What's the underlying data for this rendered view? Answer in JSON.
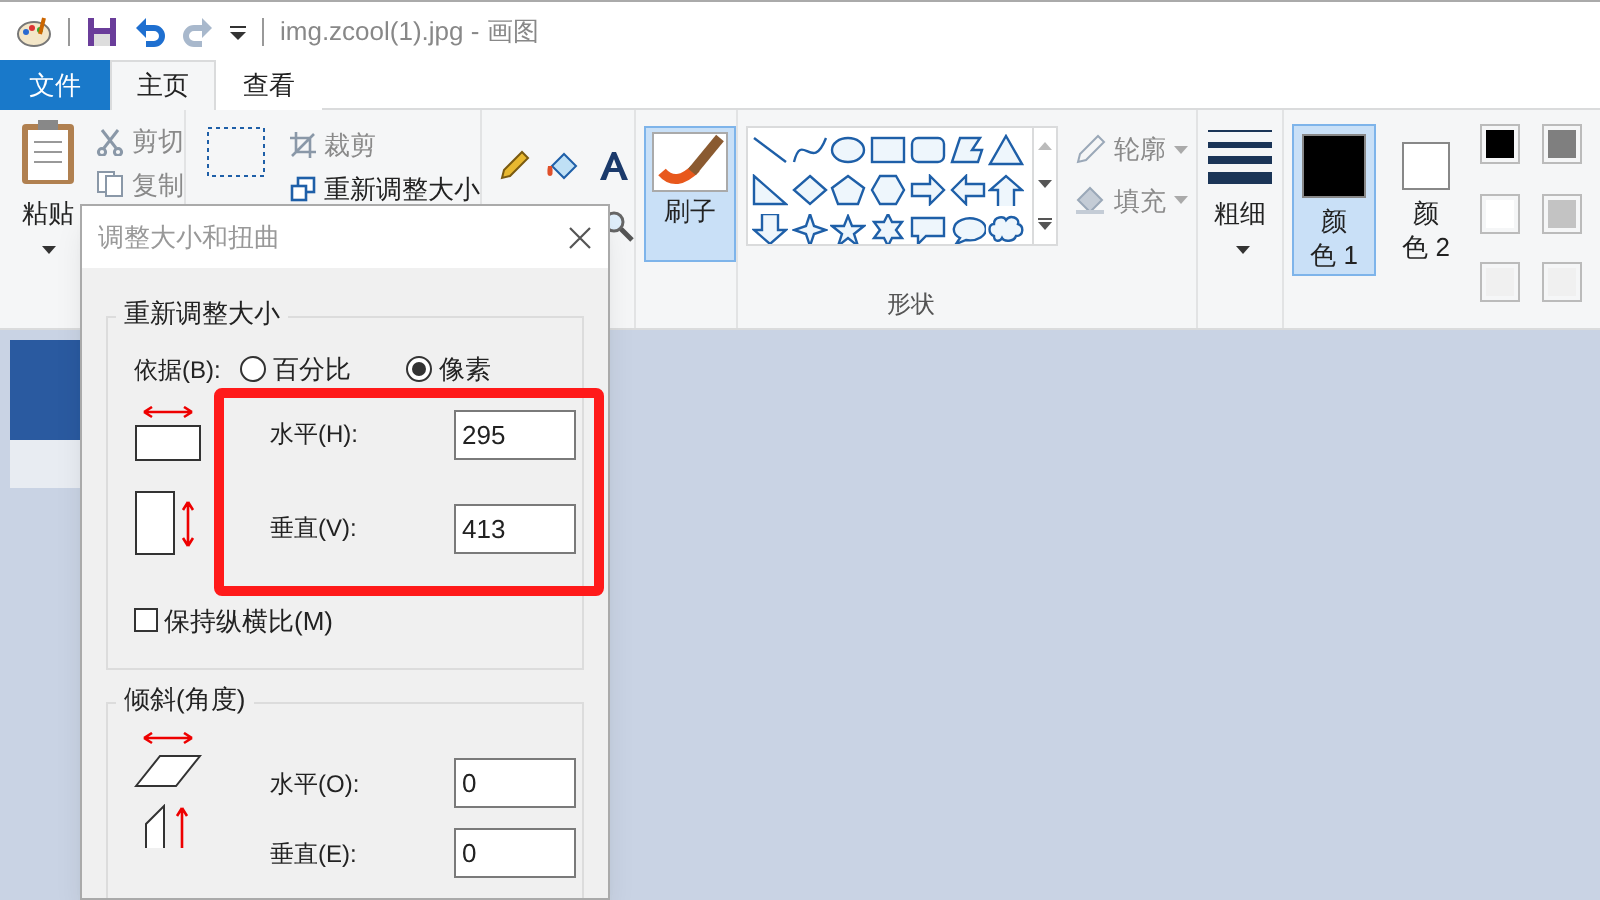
{
  "window": {
    "title": "img.zcool(1).jpg - 画图"
  },
  "tabs": [
    {
      "label": "文件",
      "kind": "file",
      "selected": false
    },
    {
      "label": "主页",
      "kind": "tab",
      "selected": true
    },
    {
      "label": "查看",
      "kind": "tab",
      "selected": false
    }
  ],
  "ribbon": {
    "clipboard": {
      "paste": "粘贴",
      "cut": {
        "label": "剪切",
        "disabled": true
      },
      "copy": {
        "label": "复制",
        "disabled": true
      }
    },
    "image": {
      "crop": {
        "label": "裁剪",
        "disabled": true
      },
      "resize": {
        "label": "重新调整大小",
        "disabled": false
      }
    },
    "brushes": {
      "label": "刷子",
      "selected": true
    },
    "shapes": {
      "label": "形状",
      "outline": {
        "label": "轮廓",
        "disabled": true
      },
      "fill": {
        "label": "填充",
        "disabled": true
      }
    },
    "size": {
      "label": "粗细"
    },
    "colors": [
      {
        "label": "颜色 1",
        "selected": true,
        "color": "#000000"
      },
      {
        "label": "颜色 2",
        "selected": false,
        "color": "#ffffff"
      }
    ],
    "palette": [
      {
        "color": "#000000"
      },
      {
        "color": "#7f7f7f"
      },
      {
        "color": "#ffffff"
      },
      {
        "color": "#c3c3c3"
      },
      {
        "color": "#f0f0f0"
      },
      {
        "color": "#f0f0f0"
      }
    ]
  },
  "dialog": {
    "title": "调整大小和扭曲",
    "resize": {
      "title": "重新调整大小",
      "by_label": "依据(B):",
      "options": [
        {
          "label": "百分比",
          "selected": false
        },
        {
          "label": "像素",
          "selected": true
        }
      ],
      "fields": [
        {
          "label": "水平(H):",
          "value": "295"
        },
        {
          "label": "垂直(V):",
          "value": "413"
        }
      ],
      "keep_ratio": {
        "label": "保持纵横比(M)",
        "checked": false
      }
    },
    "skew": {
      "title": "倾斜(角度)",
      "fields": [
        {
          "label": "水平(O):",
          "value": "0"
        },
        {
          "label": "垂直(E):",
          "value": "0"
        }
      ]
    }
  }
}
